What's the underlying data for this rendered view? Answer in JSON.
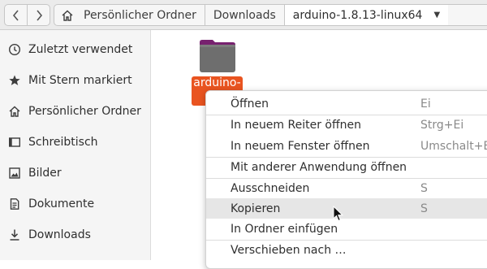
{
  "nav": {
    "back": "<",
    "forward": ">"
  },
  "breadcrumb": [
    "Persönlicher Ordner",
    "Downloads",
    "arduino-1.8.13-linux64"
  ],
  "sidebar": {
    "items": [
      {
        "label": "Zuletzt verwendet",
        "icon": "clock-icon"
      },
      {
        "label": "Mit Stern markiert",
        "icon": "star-icon"
      },
      {
        "label": "Persönlicher Ordner",
        "icon": "home-icon"
      },
      {
        "label": "Schreibtisch",
        "icon": "desktop-icon"
      },
      {
        "label": "Bilder",
        "icon": "image-icon"
      },
      {
        "label": "Dokumente",
        "icon": "document-icon"
      },
      {
        "label": "Downloads",
        "icon": "download-icon"
      }
    ]
  },
  "main": {
    "folder_label": "arduino-"
  },
  "context_menu": {
    "items": [
      {
        "label": "Öffnen",
        "shortcut": "Ei"
      },
      {
        "label": "In neuem Reiter öffnen",
        "shortcut": "Strg+Ei"
      },
      {
        "label": "In neuem Fenster öffnen",
        "shortcut": "Umschalt+Ei"
      },
      {
        "label": "Mit anderer Anwendung öffnen",
        "shortcut": ""
      },
      {
        "label": "Ausschneiden",
        "shortcut": "S"
      },
      {
        "label": "Kopieren",
        "shortcut": "S"
      },
      {
        "label": "In Ordner einfügen",
        "shortcut": ""
      },
      {
        "label": "Verschieben nach …",
        "shortcut": ""
      }
    ]
  },
  "colors": {
    "accent": "#e95420",
    "folder": "#6e6e6e",
    "folder_tab": "#77216f"
  }
}
